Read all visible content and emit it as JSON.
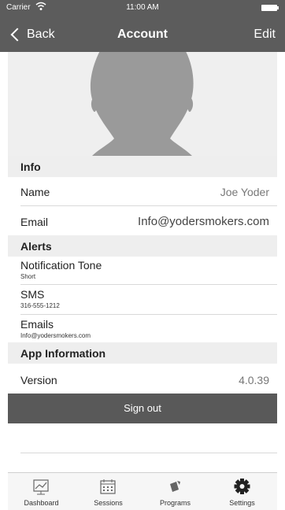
{
  "status": {
    "carrier": "Carrier",
    "time": "11:00 AM"
  },
  "nav": {
    "back_label": "Back",
    "title": "Account",
    "edit_label": "Edit"
  },
  "info": {
    "header": "Info",
    "name_label": "Name",
    "name_value": "Joe Yoder",
    "email_label": "Email",
    "email_value": "Info@yodersmokers.com"
  },
  "alerts": {
    "header": "Alerts",
    "tone_label": "Notification Tone",
    "tone_value": "Short",
    "sms_label": "SMS",
    "sms_value": "316-555-1212",
    "emails_label": "Emails",
    "emails_value": "Info@yodersmokers.com"
  },
  "app_info": {
    "header": "App Information",
    "version_label": "Version",
    "version_value": "4.0.39"
  },
  "sign_out_label": "Sign out",
  "tabs": [
    {
      "label": "Dashboard",
      "icon": "dashboard-icon"
    },
    {
      "label": "Sessions",
      "icon": "calendar-icon"
    },
    {
      "label": "Programs",
      "icon": "programs-icon"
    },
    {
      "label": "Settings",
      "icon": "gear-icon"
    }
  ],
  "colors": {
    "nav_bar": "#5c5c5c",
    "sign_out": "#595959",
    "section_bg": "#eeeeee"
  }
}
